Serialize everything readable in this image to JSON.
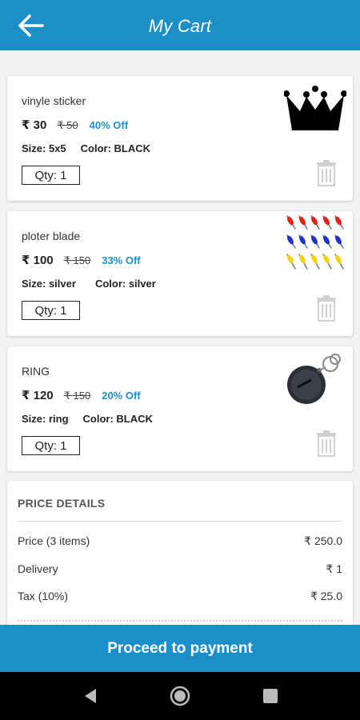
{
  "appbar": {
    "title": "My Cart"
  },
  "items": [
    {
      "name": "vinyle sticker",
      "price": "₹ 30",
      "mrp": "₹ 50",
      "discount": "40% Off",
      "size": "Size: 5x5",
      "color": "Color:  BLACK",
      "qty": "Qty: 1",
      "thumb": "crown-image"
    },
    {
      "name": "ploter blade",
      "price": "₹ 100",
      "mrp": "₹ 150",
      "discount": "33% Off",
      "size": "Size: silver",
      "color": "Color: silver",
      "qty": "Qty: 1",
      "thumb": "blades-image"
    },
    {
      "name": "RING",
      "price": "₹ 120",
      "mrp": "₹ 150",
      "discount": "20% Off",
      "size": "Size: ring",
      "color": "Color:  BLACK",
      "qty": "Qty: 1",
      "thumb": "keyring-image"
    }
  ],
  "price_details": {
    "title": "PRICE DETAILS",
    "rows": [
      {
        "label": "Price (3 items)",
        "value": "₹ 250.0"
      },
      {
        "label": "Delivery",
        "value": "₹ 1"
      },
      {
        "label": "Tax (10%)",
        "value": "₹ 25.0"
      }
    ]
  },
  "proceed_label": "Proceed to payment",
  "colors": {
    "primary": "#1d8fc8",
    "background": "#f2f2f2",
    "navbar": "#000000"
  }
}
